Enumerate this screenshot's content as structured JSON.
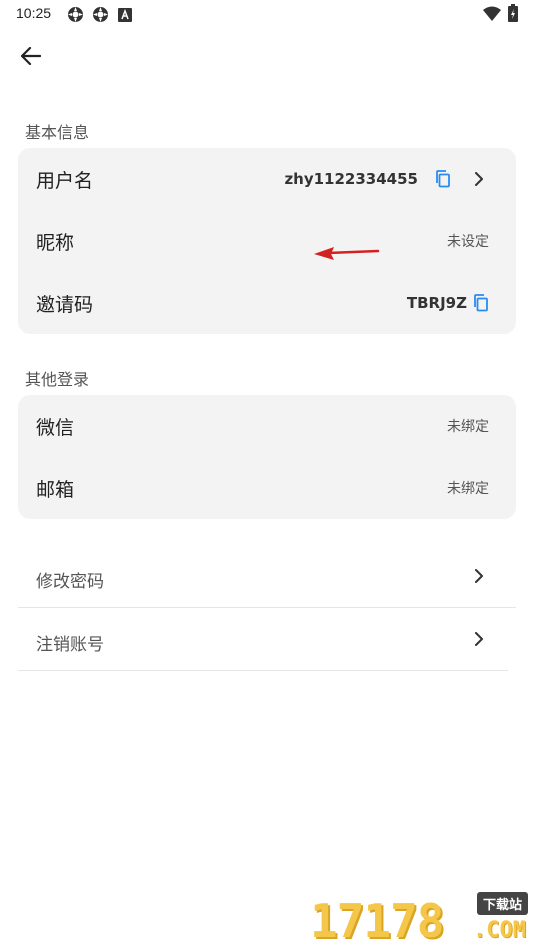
{
  "status_bar": {
    "time": "10:25",
    "icons": [
      "sync-icon",
      "sync-icon",
      "keyboard-a-icon",
      "wifi-icon",
      "battery-charging-icon"
    ]
  },
  "header": {
    "back_icon": "arrow-left-icon"
  },
  "basic_info": {
    "title": "基本信息",
    "rows": [
      {
        "label": "用户名",
        "value": "zhy1122334455",
        "copy_icon": "copy-icon",
        "chevron": "chevron-right-icon"
      },
      {
        "label": "昵称",
        "value": "未设定"
      },
      {
        "label": "邀请码",
        "value": "TBRJ9Z",
        "copy_icon": "copy-icon"
      }
    ]
  },
  "other_login": {
    "title": "其他登录",
    "rows": [
      {
        "label": "微信",
        "value": "未绑定"
      },
      {
        "label": "邮箱",
        "value": "未绑定"
      }
    ]
  },
  "actions": [
    {
      "label": "修改密码",
      "chevron": "chevron-right-icon"
    },
    {
      "label": "注销账号",
      "chevron": "chevron-right-icon"
    }
  ],
  "annotation": {
    "icon": "red-arrow-icon",
    "color": "#d32020"
  },
  "watermark": {
    "digits": "17178",
    "badge": "下载站",
    "suffix": ".COM"
  },
  "colors": {
    "accent": "#2a8cf0",
    "card_bg": "#f3f3f4"
  }
}
